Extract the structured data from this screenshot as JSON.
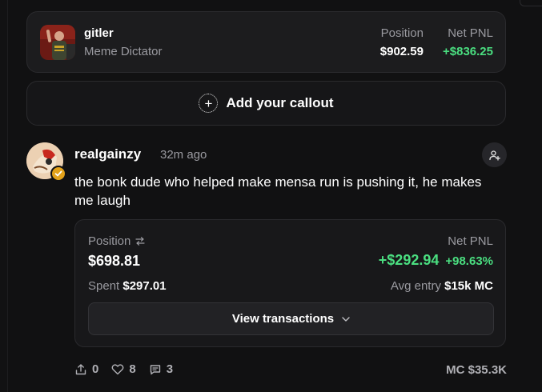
{
  "pinned": {
    "name": "gitler",
    "subtitle": "Meme Dictator",
    "position_label": "Position",
    "position_value": "$902.59",
    "pnl_label": "Net PNL",
    "pnl_value": "+$836.25"
  },
  "callout": {
    "label": "Add your callout",
    "icon": "plus-circle-icon"
  },
  "post": {
    "username": "realgainzy",
    "time": "32m ago",
    "text": "the bonk dude who helped make mensa run is pushing it, he makes me laugh",
    "badge_icon": "verified-check-icon",
    "follow_icon": "add-user-icon"
  },
  "position_card": {
    "position_label": "Position",
    "position_value": "$698.81",
    "pnl_label": "Net PNL",
    "pnl_amount": "+$292.94",
    "pnl_percent": "+98.63%",
    "spent_label": "Spent",
    "spent_value": "$297.01",
    "avg_entry_label": "Avg entry",
    "avg_entry_value": "$15k MC",
    "view_transactions": "View transactions"
  },
  "actions": {
    "share_count": "0",
    "like_count": "8",
    "comment_count": "3",
    "market_cap": "MC $35.3K"
  },
  "colors": {
    "background": "#111112",
    "card": "#1c1c1e",
    "positive": "#4ade80",
    "muted": "#9a9aa0",
    "badge": "#e3a21a"
  }
}
